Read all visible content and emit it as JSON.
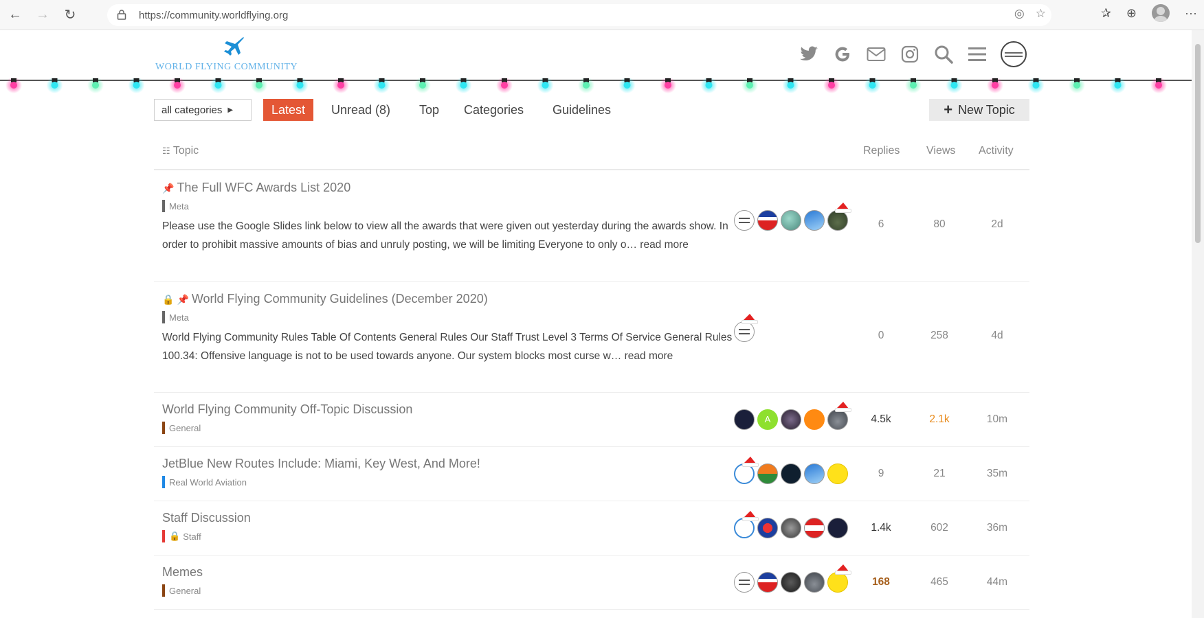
{
  "browser": {
    "url": "https://community.worldflying.org",
    "back_icon": "arrow-left-icon",
    "forward_icon": "arrow-right-icon",
    "refresh_icon": "refresh-icon"
  },
  "site": {
    "logo_text": "WORLD FLYING COMMUNITY",
    "logo_icon": "airplane-icon",
    "header_icons": [
      "twitter-icon",
      "google-icon",
      "mail-icon",
      "instagram-icon",
      "search-icon",
      "hamburger-menu-icon"
    ]
  },
  "nav": {
    "category_filter": "all categories",
    "tabs": [
      {
        "label": "Latest",
        "active": true
      },
      {
        "label": "Unread (8)",
        "active": false
      },
      {
        "label": "Top",
        "active": false
      },
      {
        "label": "Categories",
        "active": false
      },
      {
        "label": "Guidelines",
        "active": false
      }
    ],
    "new_topic": "New Topic"
  },
  "table": {
    "headers": {
      "topic": "Topic",
      "replies": "Replies",
      "views": "Views",
      "activity": "Activity"
    },
    "rows": [
      {
        "title": "The Full WFC Awards List 2020",
        "pinned": true,
        "locked": false,
        "category": "Meta",
        "category_color": "#666666",
        "excerpt": "Please use the Google Slides link below to view all the awards that were given out yesterday during the awards show. In order to prohibit massive amounts of bias and unruly posting, we will be limiting Everyone to only o…",
        "read_more": "read more",
        "replies": "6",
        "views": "80",
        "activity": "2d"
      },
      {
        "title": "World Flying Community Guidelines (December 2020)",
        "pinned": true,
        "locked": true,
        "category": "Meta",
        "category_color": "#666666",
        "excerpt": "World Flying Community Rules Table Of Contents General Rules Our Staff Trust Level 3 Terms Of Service General Rules 100.34: Offensive language is not to be used towards anyone. Our system blocks most curse w…",
        "read_more": "read more",
        "replies": "0",
        "views": "258",
        "activity": "4d"
      },
      {
        "title": "World Flying Community Off-Topic Discussion",
        "category": "General",
        "category_color": "#8b4513",
        "replies": "4.5k",
        "views": "2.1k",
        "activity": "10m"
      },
      {
        "title": "JetBlue New Routes Include: Miami, Key West, And More!",
        "category": "Real World Aviation",
        "category_color": "#1e88e5",
        "replies": "9",
        "views": "21",
        "activity": "35m"
      },
      {
        "title": "Staff Discussion",
        "category": "Staff",
        "category_color": "#e53935",
        "replies": "1.4k",
        "views": "602",
        "activity": "36m"
      },
      {
        "title": "Memes",
        "category": "General",
        "category_color": "#8b4513",
        "replies": "168",
        "views": "465",
        "activity": "44m"
      }
    ]
  }
}
